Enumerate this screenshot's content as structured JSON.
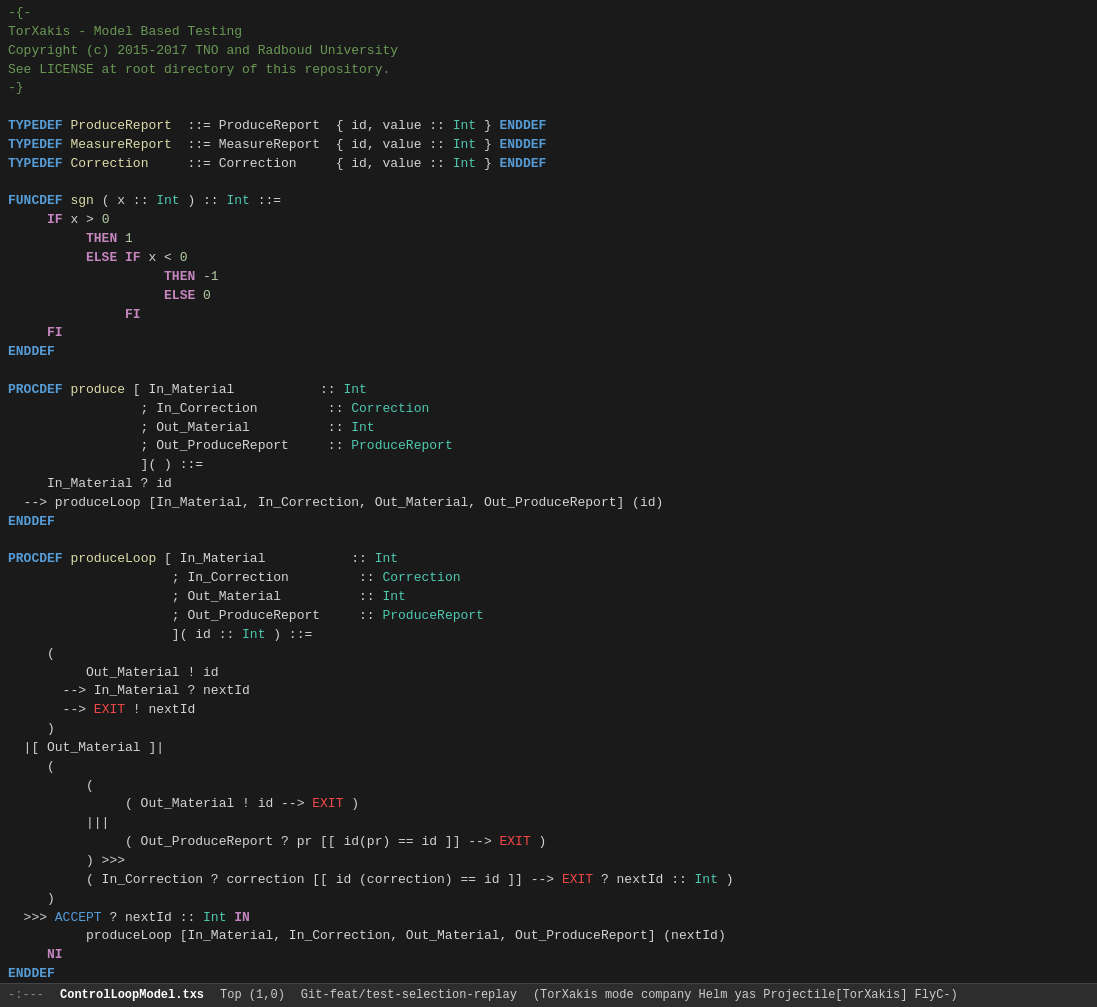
{
  "editor": {
    "title": "ControlLoopModel.txs",
    "lines": []
  },
  "statusBar": {
    "dashes": "-:---",
    "filename": "ControlLoopModel.txs",
    "position": "Top (1,0)",
    "branch": "Git-feat/test-selection-replay",
    "mode": "(TorXakis mode company Helm yas Projectile[TorXakis] FlyC-)"
  }
}
